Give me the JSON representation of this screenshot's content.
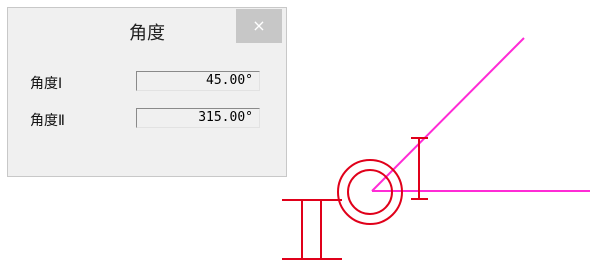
{
  "dialog": {
    "title": "角度",
    "close_glyph": "×",
    "rows": [
      {
        "label": "角度Ⅰ",
        "value": "45.00°"
      },
      {
        "label": "角度Ⅱ",
        "value": "315.00°"
      }
    ]
  },
  "canvas": {
    "colors": {
      "red": "#e0001a",
      "magenta": "#ff2bd6",
      "dialog_bg": "#f0f0f0",
      "close_bg": "#c7c7c7"
    },
    "angle_one_deg": 45,
    "angle_two_deg": 315
  }
}
